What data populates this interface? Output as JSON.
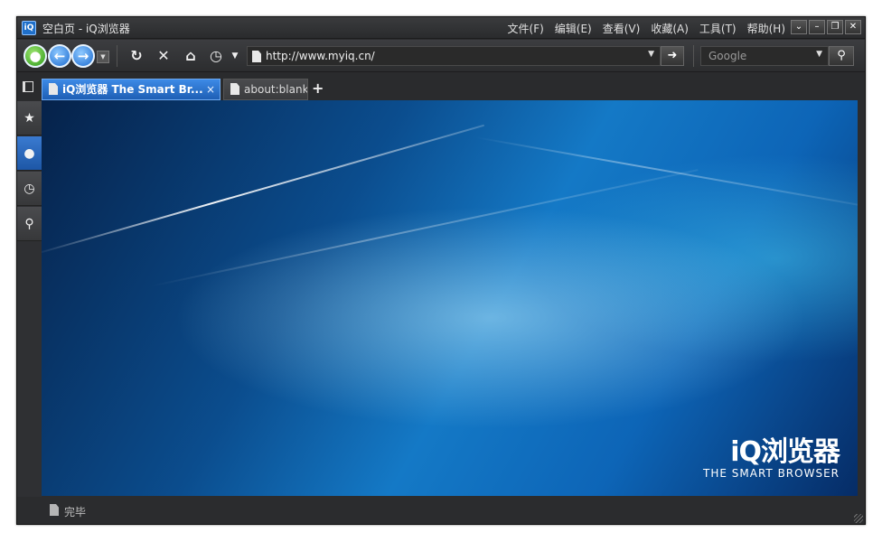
{
  "window": {
    "title": "空白页 - iQ浏览器",
    "logo": "iQ",
    "controls": {
      "extra": "⌄",
      "minimize": "–",
      "restore": "❐",
      "close": "✕"
    }
  },
  "menu": [
    "文件(F)",
    "编辑(E)",
    "查看(V)",
    "收藏(A)",
    "工具(T)",
    "帮助(H)"
  ],
  "toolbar": {
    "user_icon": "user-icon",
    "back_icon": "back-arrow-icon",
    "forward_icon": "forward-arrow-icon",
    "address": "http://www.myiq.cn/",
    "search_engine": "Google"
  },
  "tabs": [
    {
      "label": "iQ浏览器 The Smart Br...",
      "active": true
    },
    {
      "label": "about:blank",
      "active": false
    }
  ],
  "sidebar": [
    "favorites-star-icon",
    "user-icon",
    "history-clock-icon",
    "search-icon"
  ],
  "brand": {
    "name": "iQ浏览器",
    "tagline": "THE SMART BROWSER"
  },
  "status": {
    "text": "完毕"
  },
  "colors": {
    "accent": "#1e5fb5",
    "chrome": "#2b2c2e"
  }
}
